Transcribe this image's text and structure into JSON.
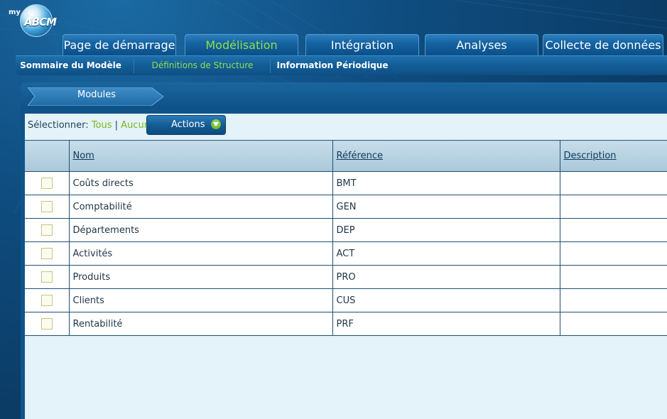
{
  "logo": {
    "prefix": "my",
    "text": "ABCM"
  },
  "main_tabs": [
    {
      "label": "Page de démarrage",
      "active": false
    },
    {
      "label": "Modélisation",
      "active": true
    },
    {
      "label": "Intégration",
      "active": false
    },
    {
      "label": "Analyses",
      "active": false
    },
    {
      "label": "Collecte de données",
      "active": false
    }
  ],
  "sub_nav": [
    {
      "label": "Sommaire du Modèle",
      "active": false
    },
    {
      "label": "Définitions de Structure",
      "active": true
    },
    {
      "label": "Information Périodique",
      "active": false
    }
  ],
  "panel": {
    "title": "Modules"
  },
  "toolbar": {
    "select_label": "Sélectionner:",
    "all_label": "Tous",
    "separator": "|",
    "none_label": "Aucun",
    "actions_label": "Actions"
  },
  "table": {
    "columns": [
      "Nom",
      "Référence",
      "Description"
    ],
    "rows": [
      {
        "name": "Coûts directs",
        "ref": "BMT",
        "desc": ""
      },
      {
        "name": "Comptabilité",
        "ref": "GEN",
        "desc": ""
      },
      {
        "name": "Départements",
        "ref": "DEP",
        "desc": ""
      },
      {
        "name": "Activités",
        "ref": "ACT",
        "desc": ""
      },
      {
        "name": "Produits",
        "ref": "PRO",
        "desc": ""
      },
      {
        "name": "Clients",
        "ref": "CUS",
        "desc": ""
      },
      {
        "name": "Rentabilité",
        "ref": "PRF",
        "desc": ""
      }
    ]
  },
  "colors": {
    "accent_green": "#8fe04a",
    "link_green": "#7cb51c",
    "navy": "#0b3f68"
  }
}
